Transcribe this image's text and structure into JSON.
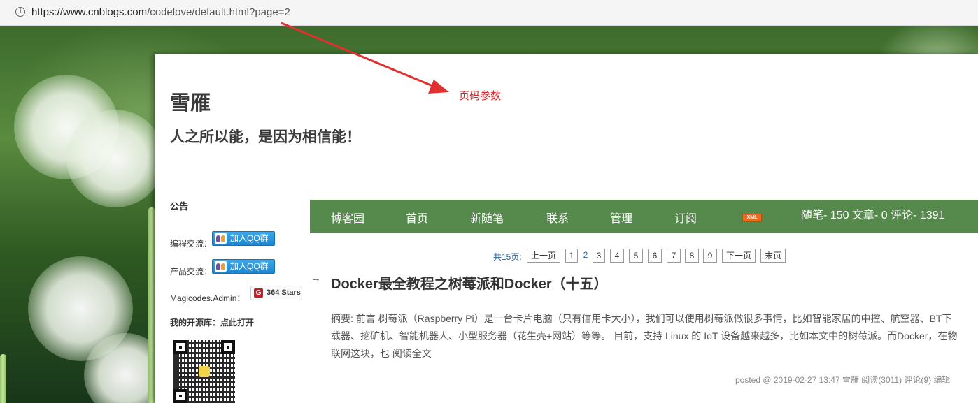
{
  "browser": {
    "url_host": "https://www.cnblogs.com",
    "url_path": "/codelove/default.html?page=2",
    "info_icon": "info-icon"
  },
  "blog": {
    "title": "雪雁",
    "subtitle": "人之所以能，是因为相信能！"
  },
  "annotation": {
    "label": "页码参数",
    "color": "#d9232a"
  },
  "sidebar": {
    "heading": "公告",
    "items": [
      {
        "label": "编程交流：",
        "button": "加入QQ群"
      },
      {
        "label": "产品交流：",
        "button": "加入QQ群"
      }
    ],
    "magicodes_label": "Magicodes.Admin：",
    "stars": "364 Stars",
    "open_source": "我的开源库：点此打开"
  },
  "nav": {
    "items": [
      "博客园",
      "首页",
      "新随笔",
      "联系",
      "管理",
      "订阅"
    ],
    "xml": "XML",
    "stats": "随笔- 150  文章- 0  评论- 1391",
    "bg": "#56894c"
  },
  "pager": {
    "total": "共15页:",
    "prev": "上一页",
    "pages": [
      "1",
      "2",
      "3",
      "4",
      "5",
      "6",
      "7",
      "8",
      "9"
    ],
    "current": "2",
    "next": "下一页",
    "last": "末页"
  },
  "post": {
    "title": "Docker最全教程之树莓派和Docker（十五）",
    "summary": "摘要: 前言 树莓派（Raspberry Pi）是一台卡片电脑（只有信用卡大小），我们可以使用树莓派做很多事情，比如智能家居的中控、航空器、BT下载器、挖矿机、智能机器人、小型服务器（花生壳+网站）等等。 目前，支持 Linux 的 IoT 设备越来越多，比如本文中的树莓派。而Docker，在物联网这块，也",
    "read_more": "阅读全文",
    "footer": "posted @ 2019-02-27 13:47 雪雁 阅读(3011) 评论(9) 编辑"
  }
}
